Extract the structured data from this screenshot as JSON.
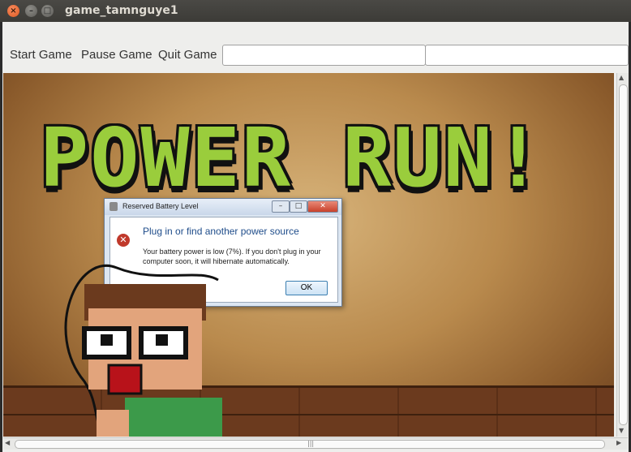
{
  "window": {
    "title": "game_tamnguye1"
  },
  "toolbar": {
    "start_label": "Start Game",
    "pause_label": "Pause Game",
    "quit_label": "Quit Game",
    "field1_value": "",
    "field2_value": ""
  },
  "game": {
    "logo_text": "POWER RUN!",
    "dialog": {
      "title": "Reserved Battery Level",
      "heading": "Plug in or find another power source",
      "message": "Your battery power is low (7%). If you don't plug in your computer soon, it will hibernate automatically.",
      "ok_label": "OK"
    }
  },
  "colors": {
    "logo_green": "#9acd3c",
    "window_close": "#e05a23",
    "titlebar": "#3c3b37"
  },
  "icons": {
    "close": "close-icon",
    "minimize": "minimize-icon",
    "maximize": "maximize-icon",
    "warning": "battery-warning-icon"
  }
}
